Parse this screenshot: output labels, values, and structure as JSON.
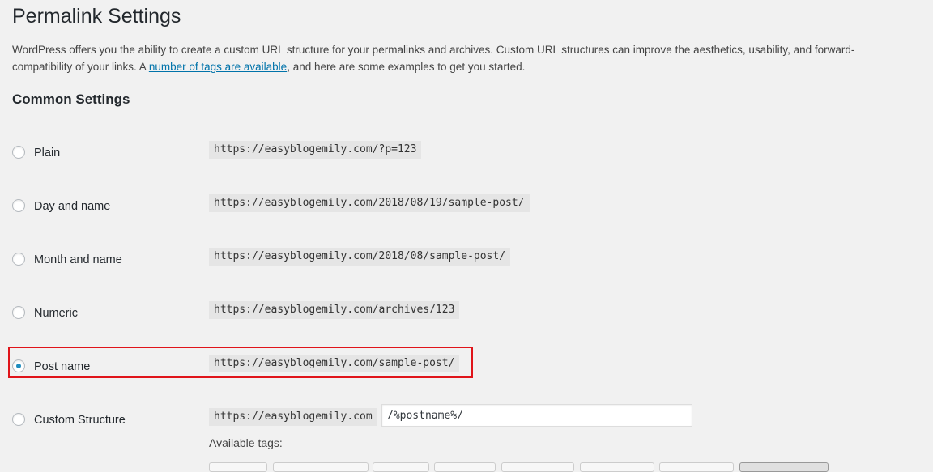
{
  "page": {
    "title": "Permalink Settings",
    "intro_before_link": "WordPress offers you the ability to create a custom URL structure for your permalinks and archives. Custom URL structures can improve the aesthetics, usability, and forward-compatibility of your links. A ",
    "intro_link": "number of tags are available",
    "intro_after_link": ", and here are some examples to get you started."
  },
  "common_settings": {
    "heading": "Common Settings",
    "options": [
      {
        "label": "Plain",
        "example": "https://easyblogemily.com/?p=123"
      },
      {
        "label": "Day and name",
        "example": "https://easyblogemily.com/2018/08/19/sample-post/"
      },
      {
        "label": "Month and name",
        "example": "https://easyblogemily.com/2018/08/sample-post/"
      },
      {
        "label": "Numeric",
        "example": "https://easyblogemily.com/archives/123"
      },
      {
        "label": "Post name",
        "example": "https://easyblogemily.com/sample-post/"
      },
      {
        "label": "Custom Structure",
        "example": "https://easyblogemily.com"
      }
    ],
    "selected": "Post name",
    "custom_structure_value": "/%postname%/",
    "available_tags_label": "Available tags:"
  },
  "colors": {
    "link": "#0073aa",
    "radio_selected": "#1e8cbe",
    "highlight_outline": "#e0141a"
  }
}
